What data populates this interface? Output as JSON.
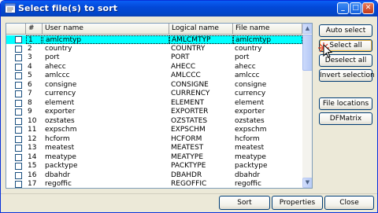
{
  "window": {
    "title": "Select file(s) to sort",
    "min_label": "_",
    "max_label": "□",
    "close_label": "✕"
  },
  "grid": {
    "columns": [
      "#",
      "User name",
      "Logical name",
      "File name"
    ],
    "rows": [
      {
        "num": "1",
        "user": "amlcmtyp",
        "logical": "AMLCMTYP",
        "file": "amlcmtyp",
        "selected": true
      },
      {
        "num": "2",
        "user": "country",
        "logical": "COUNTRY",
        "file": "country"
      },
      {
        "num": "3",
        "user": "port",
        "logical": "PORT",
        "file": "port"
      },
      {
        "num": "4",
        "user": "ahecc",
        "logical": "AHECC",
        "file": "ahecc"
      },
      {
        "num": "5",
        "user": "amlccc",
        "logical": "AMLCCC",
        "file": "amlccc"
      },
      {
        "num": "6",
        "user": "consigne",
        "logical": "CONSIGNE",
        "file": "consigne"
      },
      {
        "num": "7",
        "user": "currency",
        "logical": "CURRENCY",
        "file": "currency"
      },
      {
        "num": "8",
        "user": "element",
        "logical": "ELEMENT",
        "file": "element"
      },
      {
        "num": "9",
        "user": "exporter",
        "logical": "EXPORTER",
        "file": "exporter"
      },
      {
        "num": "10",
        "user": "ozstates",
        "logical": "OZSTATES",
        "file": "ozstates"
      },
      {
        "num": "11",
        "user": "expschm",
        "logical": "EXPSCHM",
        "file": "expschm"
      },
      {
        "num": "12",
        "user": "hcform",
        "logical": "HCFORM",
        "file": "hcform"
      },
      {
        "num": "13",
        "user": "meatest",
        "logical": "MEATEST",
        "file": "meatest"
      },
      {
        "num": "14",
        "user": "meatype",
        "logical": "MEATYPE",
        "file": "meatype"
      },
      {
        "num": "15",
        "user": "packtype",
        "logical": "PACKTYPE",
        "file": "packtype"
      },
      {
        "num": "16",
        "user": "dbahdr",
        "logical": "DBAHDR",
        "file": "dbahdr"
      },
      {
        "num": "17",
        "user": "regoffic",
        "logical": "REGOFFIC",
        "file": "regoffic"
      }
    ],
    "scroll_up": "▲",
    "scroll_down": "▼"
  },
  "side_buttons": {
    "auto_select": "Auto select",
    "select_all": "Select all",
    "deselect_all": "Deselect all",
    "invert_selection": "Invert selection",
    "file_locations": "File locations",
    "dfmatrix": "DFMatrix"
  },
  "bottom_buttons": {
    "sort": "Sort",
    "properties": "Properties",
    "close": "Close"
  },
  "colors": {
    "selected_row": "#00ffff",
    "title_bar": "#0348d8"
  }
}
